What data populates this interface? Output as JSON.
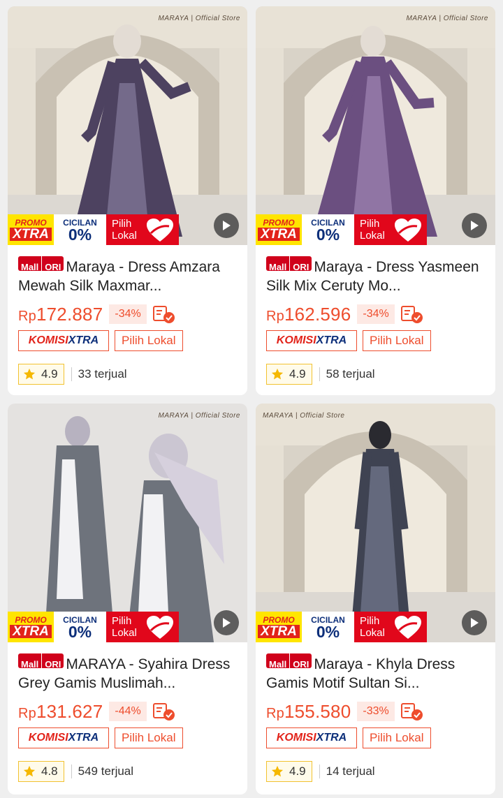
{
  "badges": {
    "promo_top": "PROMO",
    "promo_bottom": "XTRA",
    "cicilan_top": "CICILAN",
    "cicilan_bottom": "0%",
    "lokal_line1": "Pilih",
    "lokal_line2": "Lokal"
  },
  "labels": {
    "mall": "Mall",
    "ori": "ORI",
    "komisi_a": "KOMISI",
    "komisi_b": "XTRA",
    "pilih_lokal": "Pilih Lokal"
  },
  "store_watermark": "MARAYA | Official Store",
  "products": [
    {
      "title": "Maraya - Dress Amzara Mewah Silk Maxmar...",
      "currency": "Rp",
      "price": "172.887",
      "discount": "-34%",
      "rating": "4.9",
      "sold": "33 terjual",
      "dress_color": "#4d4260"
    },
    {
      "title": "Maraya - Dress Yasmeen Silk Mix Ceruty Mo...",
      "currency": "Rp",
      "price": "162.596",
      "discount": "-34%",
      "rating": "4.9",
      "sold": "58 terjual",
      "dress_color": "#6b4f80"
    },
    {
      "title": "MARAYA - Syahira Dress Grey Gamis Muslimah...",
      "currency": "Rp",
      "price": "131.627",
      "discount": "-44%",
      "rating": "4.8",
      "sold": "549 terjual",
      "dress_color": "#6e737c"
    },
    {
      "title": "Maraya - Khyla Dress Gamis Motif Sultan Si...",
      "currency": "Rp",
      "price": "155.580",
      "discount": "-33%",
      "rating": "4.9",
      "sold": "14 terjual",
      "dress_color": "#3f4352"
    }
  ]
}
